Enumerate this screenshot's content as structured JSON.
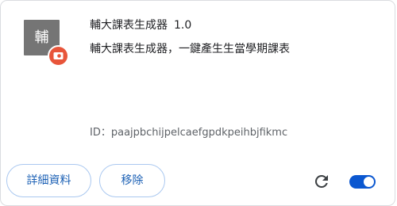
{
  "extension": {
    "icon_char": "輔",
    "name": "輔大課表生成器",
    "version": "1.0",
    "description": "輔大課表生成器，一鍵產生生當學期課表",
    "id_label": "ID：",
    "id_value": "paajpbchijpelcaefgpdkpeihbjfikmc",
    "enabled": true
  },
  "buttons": {
    "details_label": "詳細資料",
    "remove_label": "移除"
  },
  "icons": {
    "badge": "policy-badge-icon",
    "reload": "reload-icon",
    "toggle": "toggle-switch"
  },
  "colors": {
    "accent": "#0b57d0",
    "badge": "#e8553a",
    "icon_bg": "#757575"
  }
}
